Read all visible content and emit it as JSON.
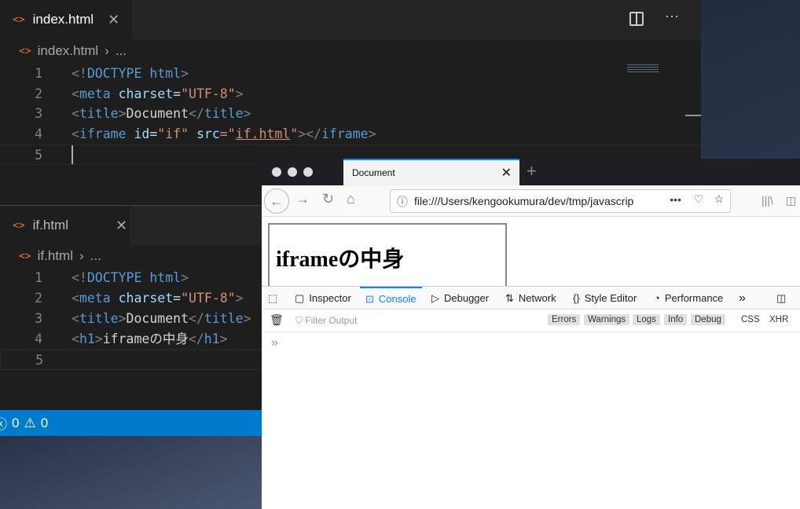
{
  "editor": {
    "group1": {
      "tab": "index.html",
      "breadcrumb": "index.html",
      "ellipsis": "...",
      "lines": [
        [
          "<!",
          "DOCTYPE html",
          ">"
        ],
        [
          "<",
          "meta",
          " charset",
          "=",
          "\"UTF-8\"",
          ">"
        ],
        [
          "<",
          "title",
          ">",
          "Document",
          "</",
          "title",
          ">"
        ],
        [
          "<",
          "iframe",
          " id",
          "=",
          "\"if\"",
          " src",
          "=\"",
          "if.html",
          "\"",
          "></",
          "iframe",
          ">"
        ]
      ],
      "line_numbers": [
        "1",
        "2",
        "3",
        "4",
        "5"
      ]
    },
    "group2": {
      "tab": "if.html",
      "breadcrumb": "if.html",
      "ellipsis": "...",
      "line_numbers": [
        "1",
        "2",
        "3",
        "4",
        "5"
      ],
      "l4_text": "iframeの中身"
    },
    "status": {
      "errors": "0",
      "warnings": "0"
    }
  },
  "browser": {
    "tab_title": "Document",
    "url": "file:///Users/kengookumura/dev/tmp/javascrip",
    "page_heading": "iframeの中身",
    "devtools": {
      "tabs": [
        "Inspector",
        "Console",
        "Debugger",
        "Network",
        "Style Editor",
        "Performance"
      ],
      "active": "Console",
      "filter_placeholder": "Filter Output",
      "levels": [
        "Errors",
        "Warnings",
        "Logs",
        "Info",
        "Debug"
      ],
      "extra": [
        "CSS",
        "XHR"
      ]
    }
  }
}
